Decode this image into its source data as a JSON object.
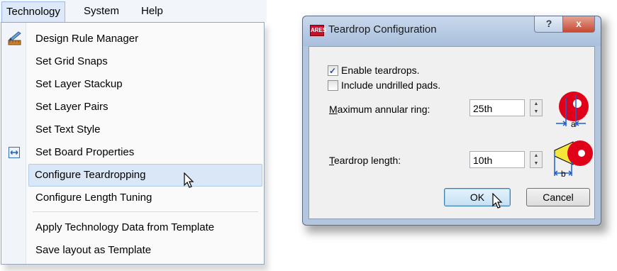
{
  "menubar": {
    "items": [
      "Technology",
      "System",
      "Help"
    ]
  },
  "menu": {
    "items": [
      "Design Rule Manager",
      "Set Grid Snaps",
      "Set Layer Stackup",
      "Set Layer Pairs",
      "Set Text Style",
      "Set Board Properties",
      "Configure Teardropping",
      "Configure Length Tuning",
      "Apply Technology Data from Template",
      "Save layout as Template"
    ],
    "highlighted": "Configure Teardropping"
  },
  "dialog": {
    "app_badge": "ARES",
    "title": "Teardrop Configuration",
    "help_label": "?",
    "close_label": "x",
    "enable_label": "Enable teardrops.",
    "enable_checked": true,
    "undrilled_label": "Include undrilled pads.",
    "undrilled_checked": false,
    "annular_label": "Maximum annular ring:",
    "annular_value": "25th",
    "length_label": "Teardrop length:",
    "length_value": "10th",
    "diagram_a": "a",
    "diagram_b": "b",
    "ok_label": "OK",
    "cancel_label": "Cancel"
  },
  "colors": {
    "pad_red": "#e0001a",
    "dim_blue": "#1f5fd0",
    "teardrop_yellow": "#f5e63a"
  }
}
